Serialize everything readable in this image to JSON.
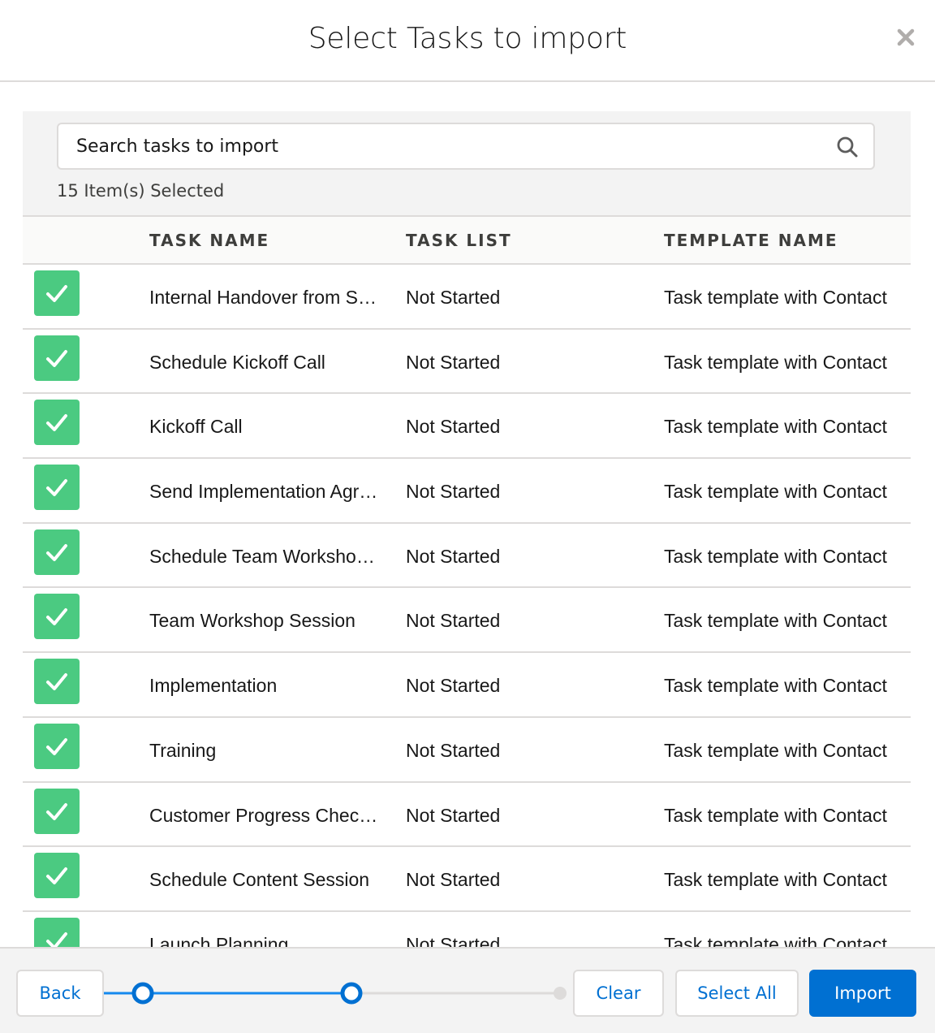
{
  "modal": {
    "title": "Select Tasks to import"
  },
  "search": {
    "placeholder": "Search tasks to import",
    "value": ""
  },
  "selection": {
    "count_text": "15 Item(s) Selected"
  },
  "table": {
    "columns": [
      "TASK NAME",
      "TASK LIST",
      "TEMPLATE NAME"
    ],
    "rows": [
      {
        "checked": true,
        "task_name": "Internal Handover from Sales",
        "task_list": "Not Started",
        "template_name": "Task template with Contact"
      },
      {
        "checked": true,
        "task_name": "Schedule Kickoff Call",
        "task_list": "Not Started",
        "template_name": "Task template with Contact"
      },
      {
        "checked": true,
        "task_name": "Kickoff Call",
        "task_list": "Not Started",
        "template_name": "Task template with Contact"
      },
      {
        "checked": true,
        "task_name": "Send Implementation Agreement",
        "task_list": "Not Started",
        "template_name": "Task template with Contact"
      },
      {
        "checked": true,
        "task_name": "Schedule Team Workshop Session",
        "task_list": "Not Started",
        "template_name": "Task template with Contact"
      },
      {
        "checked": true,
        "task_name": "Team Workshop Session",
        "task_list": "Not Started",
        "template_name": "Task template with Contact"
      },
      {
        "checked": true,
        "task_name": "Implementation",
        "task_list": "Not Started",
        "template_name": "Task template with Contact"
      },
      {
        "checked": true,
        "task_name": "Training",
        "task_list": "Not Started",
        "template_name": "Task template with Contact"
      },
      {
        "checked": true,
        "task_name": "Customer Progress Check-in",
        "task_list": "Not Started",
        "template_name": "Task template with Contact"
      },
      {
        "checked": true,
        "task_name": "Schedule Content Session",
        "task_list": "Not Started",
        "template_name": "Task template with Contact"
      },
      {
        "checked": true,
        "task_name": "Launch Planning",
        "task_list": "Not Started",
        "template_name": "Task template with Contact"
      }
    ]
  },
  "footer": {
    "back_label": "Back",
    "clear_label": "Clear",
    "select_all_label": "Select All",
    "import_label": "Import",
    "progress": {
      "current_step": 2,
      "total_steps": 3
    }
  },
  "icons": {
    "close": "close-icon",
    "search": "search-icon",
    "check": "check-icon"
  },
  "colors": {
    "brand": "#0070d2",
    "checkbox_checked": "#4bca81",
    "border": "#dddbda",
    "panel_bg": "#f3f3f3"
  }
}
